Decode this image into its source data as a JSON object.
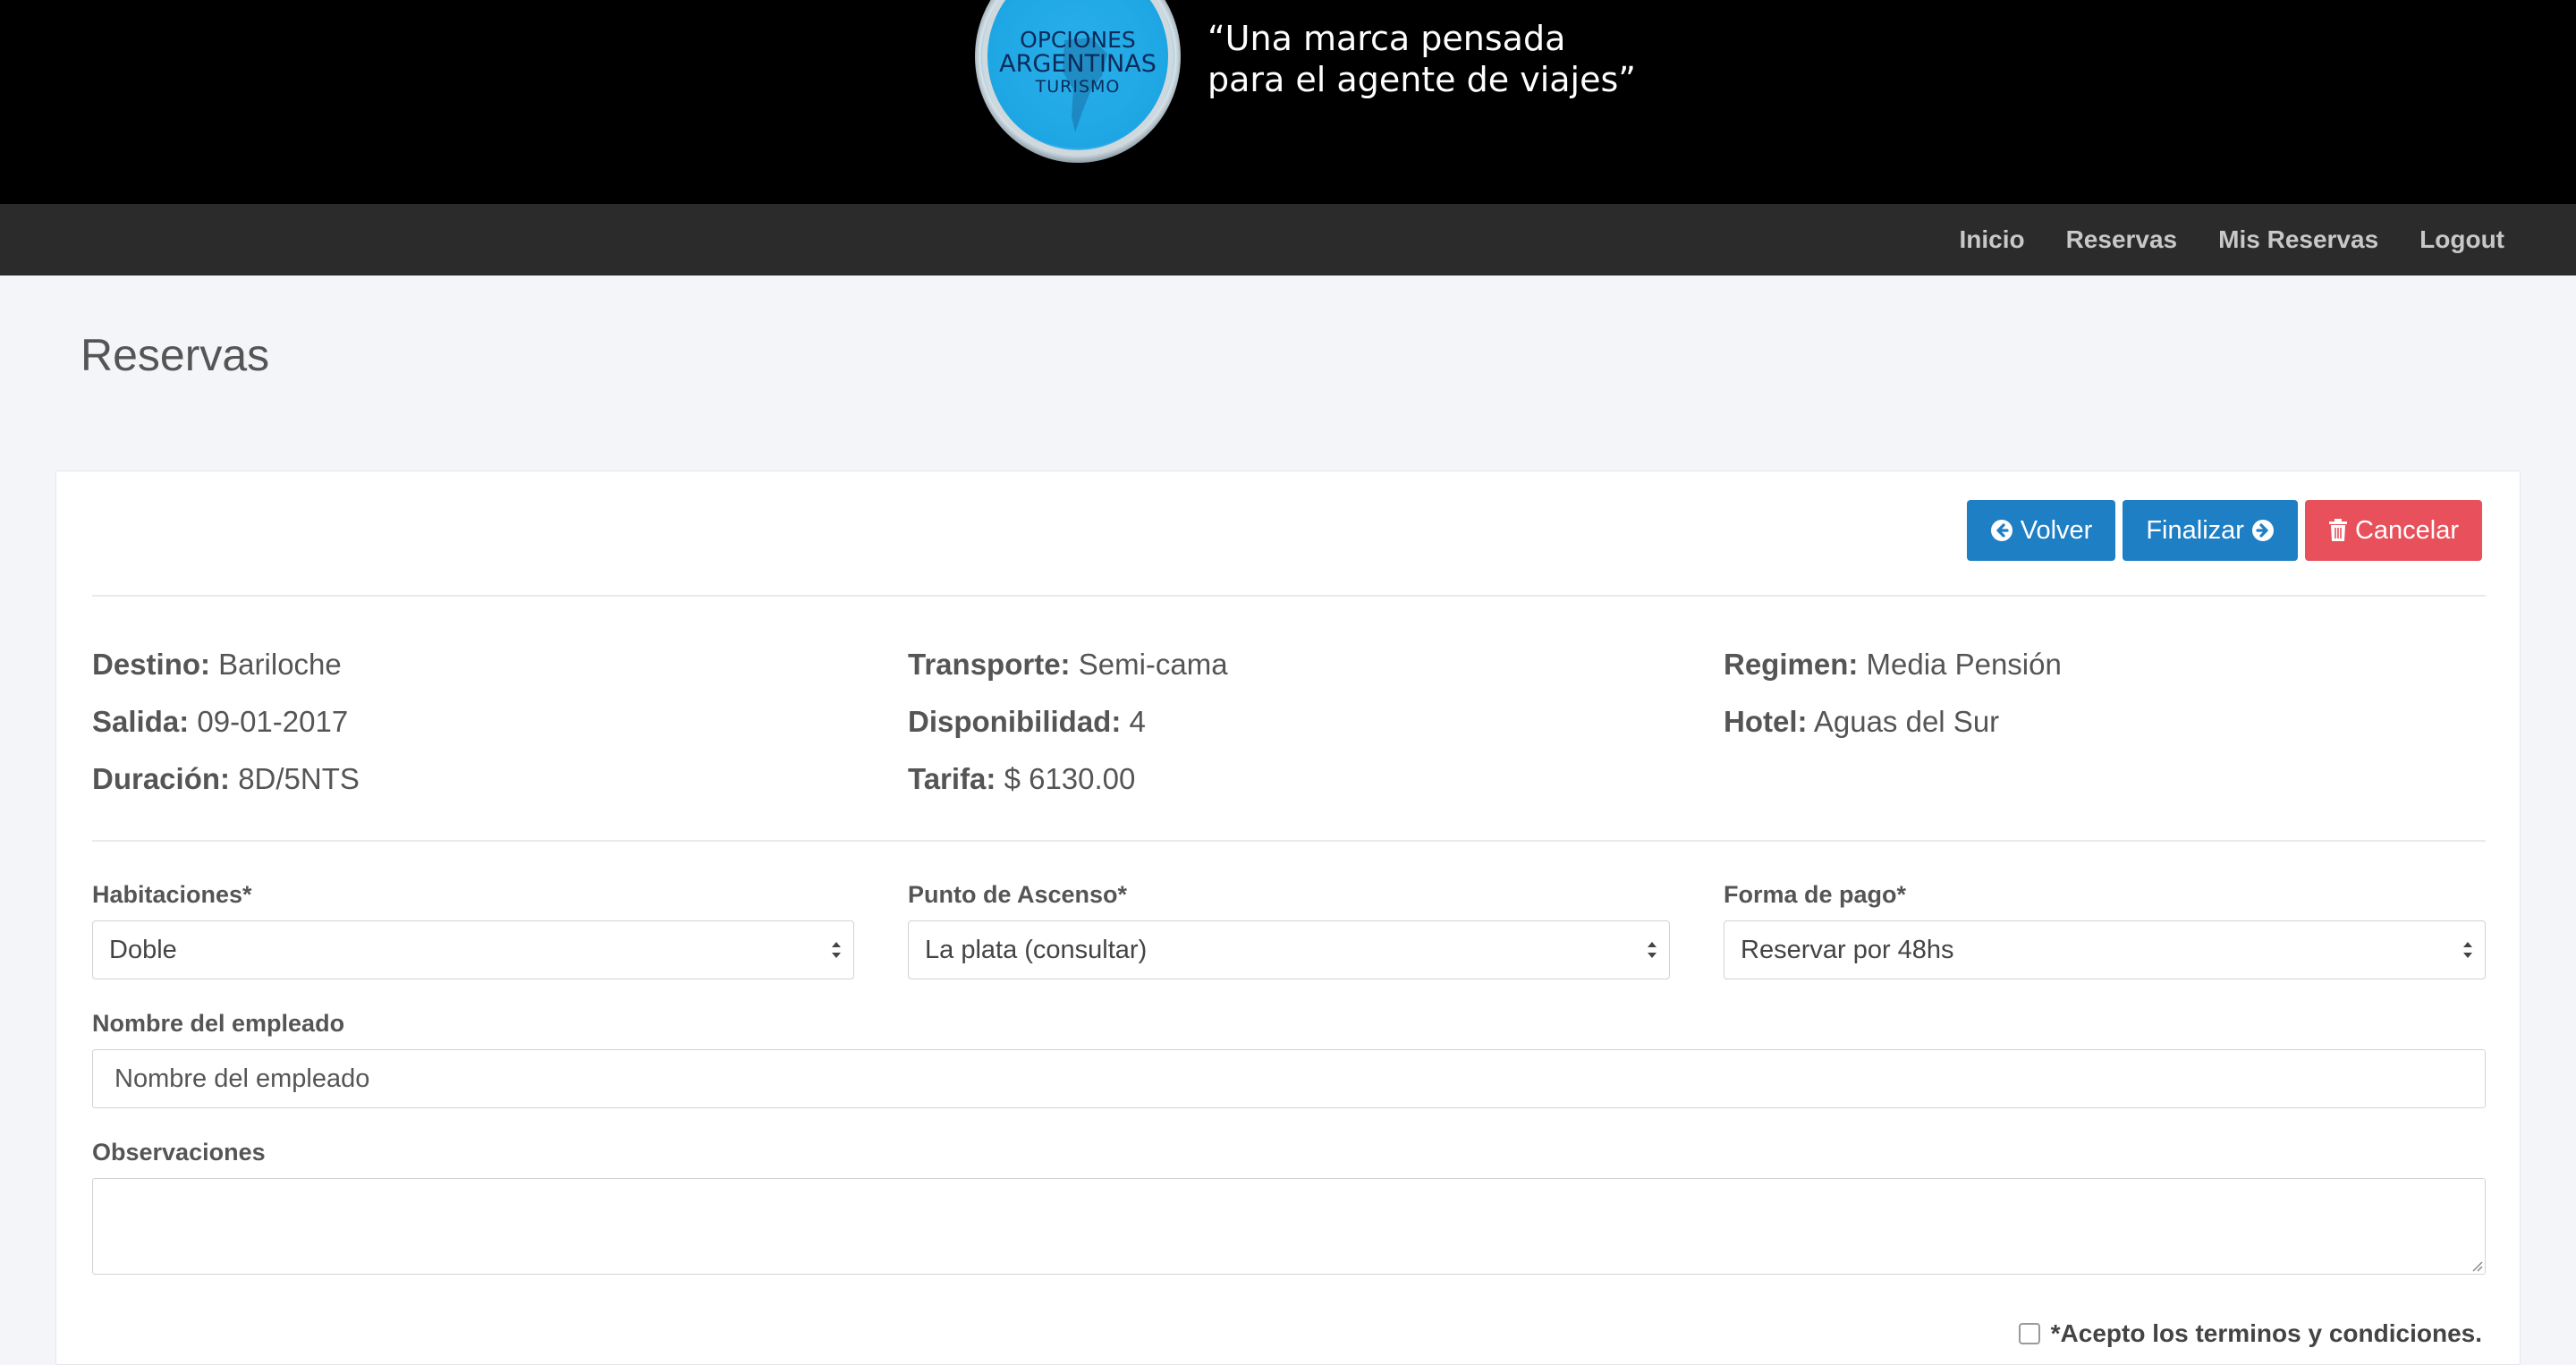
{
  "header": {
    "logo": {
      "line1": "OPCIONES",
      "line2": "ARGENTINAS",
      "line3": "TURISMO"
    },
    "tagline_line1": "“Una marca pensada",
    "tagline_line2": "para el agente de viajes”"
  },
  "nav": {
    "items": [
      {
        "label": "Inicio"
      },
      {
        "label": "Reservas"
      },
      {
        "label": "Mis Reservas"
      },
      {
        "label": "Logout"
      }
    ]
  },
  "page": {
    "title": "Reservas"
  },
  "buttons": {
    "back_label": "Volver",
    "finish_label": "Finalizar",
    "cancel_label": "Cancelar"
  },
  "info": {
    "destino": {
      "label": "Destino:",
      "value": "Bariloche"
    },
    "salida": {
      "label": "Salida:",
      "value": "09-01-2017"
    },
    "duracion": {
      "label": "Duración:",
      "value": "8D/5NTS"
    },
    "transporte": {
      "label": "Transporte:",
      "value": "Semi-cama"
    },
    "disponibilidad": {
      "label": "Disponibilidad:",
      "value": "4"
    },
    "tarifa": {
      "label": "Tarifa:",
      "value": "$ 6130.00"
    },
    "regimen": {
      "label": "Regimen:",
      "value": "Media Pensión"
    },
    "hotel": {
      "label": "Hotel:",
      "value": "Aguas del Sur"
    }
  },
  "form": {
    "habitaciones": {
      "label": "Habitaciones*",
      "value": "Doble"
    },
    "punto_ascenso": {
      "label": "Punto de Ascenso*",
      "value": "La plata (consultar)"
    },
    "forma_pago": {
      "label": "Forma de pago*",
      "value": "Reservar por 48hs"
    },
    "empleado": {
      "label": "Nombre del empleado",
      "placeholder": "Nombre del empleado"
    },
    "observaciones": {
      "label": "Observaciones"
    },
    "terms_label": "*Acepto los terminos y condiciones."
  },
  "colors": {
    "primary": "#1f7fc4",
    "danger": "#e8505b",
    "navbar": "#2b2b2b",
    "banner": "#000000"
  }
}
